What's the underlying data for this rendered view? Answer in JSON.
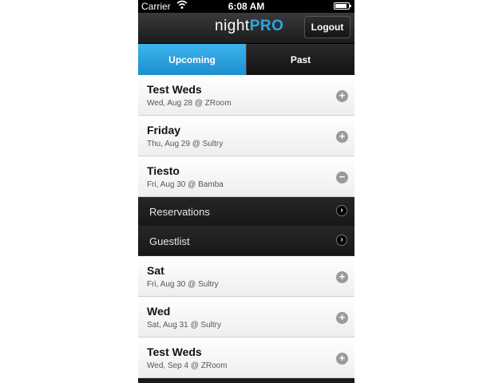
{
  "status_bar": {
    "carrier": "Carrier",
    "time": "6:08 AM"
  },
  "nav": {
    "logo_night": "night",
    "logo_pro": "PRO",
    "logout": "Logout"
  },
  "tabs": [
    {
      "label": "Upcoming",
      "active": true
    },
    {
      "label": "Past",
      "active": false
    }
  ],
  "events_top": [
    {
      "title": "Test Weds",
      "subtitle": "Wed, Aug 28 @ ZRoom",
      "action": "+"
    },
    {
      "title": "Friday",
      "subtitle": "Thu, Aug 29 @ Sultry",
      "action": "+"
    },
    {
      "title": "Tiesto",
      "subtitle": "Fri, Aug 30 @ Bamba",
      "action": "−"
    }
  ],
  "sub_menu": [
    {
      "label": "Reservations",
      "chevron": "›"
    },
    {
      "label": "Guestlist",
      "chevron": "›"
    }
  ],
  "events_bottom": [
    {
      "title": "Sat",
      "subtitle": "Fri, Aug 30 @ Sultry",
      "action": "+"
    },
    {
      "title": "Wed",
      "subtitle": "Sat, Aug 31 @ Sultry",
      "action": "+"
    },
    {
      "title": "Test Weds",
      "subtitle": "Wed, Sep 4 @ ZRoom",
      "action": "+"
    }
  ],
  "colors": {
    "accent": "#2aa7e3",
    "tab_active": "#1d8fd0",
    "dark": "#1c1c1c"
  }
}
